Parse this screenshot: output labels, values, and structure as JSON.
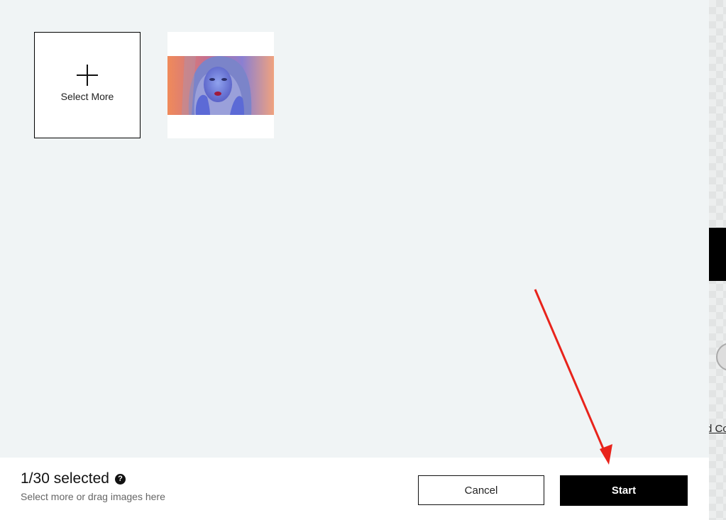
{
  "upload": {
    "select_more_label": "Select More",
    "selected_image_alt": "Portrait of a woman with hands near face, blue and orange tones"
  },
  "footer": {
    "count_text": "1/30 selected",
    "help_icon": "question-circle-icon",
    "hint_text": "Select more or drag images here",
    "cancel_label": "Cancel",
    "start_label": "Start"
  },
  "sidebar_peek": {
    "text": "d Co"
  },
  "colors": {
    "annotation_arrow": "#e8231b",
    "primary_button": "#000000",
    "background": "#f0f4f5"
  }
}
